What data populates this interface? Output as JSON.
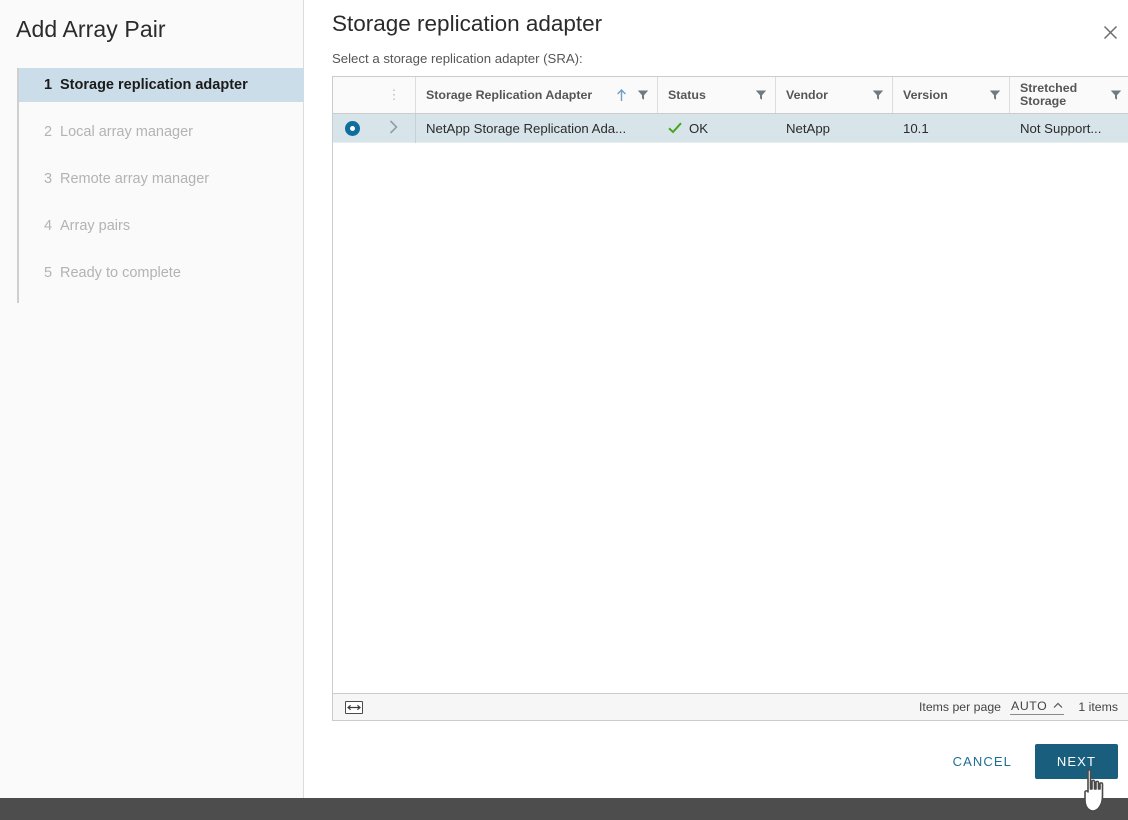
{
  "wizard": {
    "title": "Add Array Pair",
    "steps": [
      {
        "num": "1",
        "label": "Storage replication adapter",
        "active": true
      },
      {
        "num": "2",
        "label": "Local array manager",
        "active": false
      },
      {
        "num": "3",
        "label": "Remote array manager",
        "active": false
      },
      {
        "num": "4",
        "label": "Array pairs",
        "active": false
      },
      {
        "num": "5",
        "label": "Ready to complete",
        "active": false
      }
    ]
  },
  "content": {
    "title": "Storage replication adapter",
    "subtitle": "Select a storage replication adapter (SRA):",
    "close_icon": "close-icon"
  },
  "grid": {
    "columns": {
      "select": "",
      "expand": "⋮",
      "name": "Storage Replication Adapter",
      "status": "Status",
      "vendor": "Vendor",
      "version": "Version",
      "stretched": "Stretched Storage"
    },
    "sort": {
      "column": "name",
      "direction": "asc",
      "icon": "sort-ascending-icon"
    },
    "filter_icon": "filter-funnel-icon",
    "rows": [
      {
        "selected": true,
        "expand_icon": "chevron-right-icon",
        "name": "NetApp Storage Replication Ada...",
        "status": "OK",
        "status_icon": "check-ok-icon",
        "vendor": "NetApp",
        "version": "10.1",
        "stretched": "Not Support..."
      }
    ],
    "footer": {
      "column_width_icon": "column-width-icon",
      "items_per_page_label": "Items per page",
      "items_per_page_value": "AUTO",
      "items_per_page_caret": "caret-up-icon",
      "items_count": "1 items"
    }
  },
  "buttons": {
    "cancel": "CANCEL",
    "next": "NEXT"
  },
  "colors": {
    "accent": "#1a5e7e",
    "link": "#1f6f94",
    "selected_row": "#d7e4ea",
    "active_step": "#ccddea",
    "status_ok": "#3e8c29",
    "radio": "#0f6e9e",
    "sysbar": "#4d4d4d"
  }
}
